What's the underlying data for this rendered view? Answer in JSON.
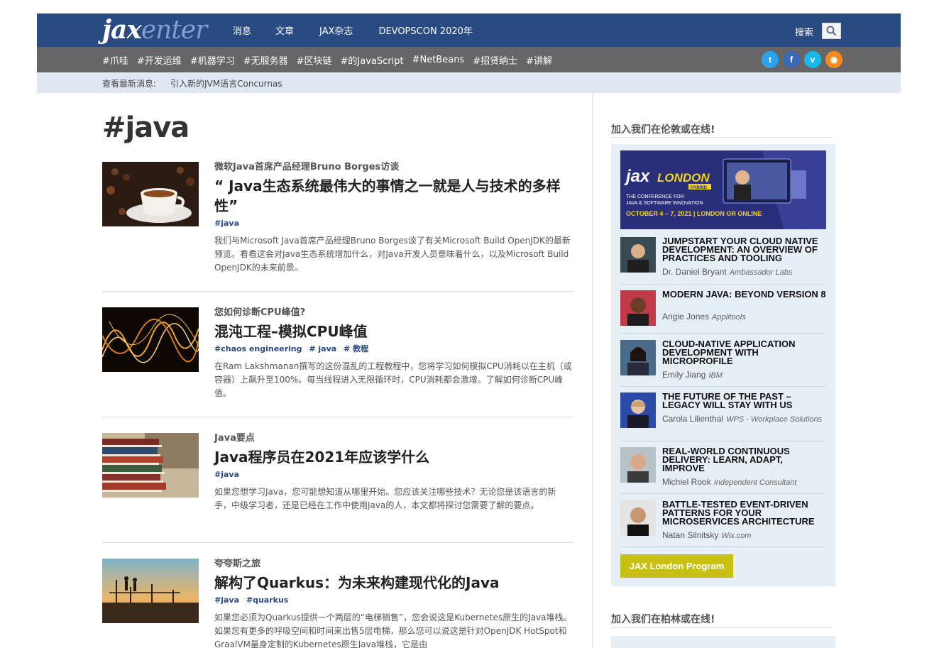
{
  "header": {
    "logo_jax": "jax",
    "logo_enter": "enter",
    "nav": [
      "消息",
      "文章",
      "JAX杂志",
      "DEVOPSCON 2020年"
    ],
    "search_label": "搜索"
  },
  "tagbar": {
    "tags": [
      "#爪哇",
      "#开发运维",
      "#机器学习",
      "#无服务器",
      "#区块链",
      "#的JavaScript",
      "#NetBeans",
      "#招贤纳士",
      "#讲解"
    ],
    "social": {
      "twitter": {
        "glyph": "t",
        "color": "#2aa3ef"
      },
      "facebook": {
        "glyph": "f",
        "color": "#3b69b5"
      },
      "vimeo": {
        "glyph": "v",
        "color": "#1ab7ea"
      },
      "rss": {
        "glyph": "◉",
        "color": "#f58a1f"
      }
    }
  },
  "ticker": {
    "label": "查看最新消息:",
    "headline": "引入新的JVM语言Concurnas"
  },
  "page_title": "#java",
  "articles": [
    {
      "kicker": "微软Java首席产品经理Bruno Borges访谈",
      "headline": "“ Java生态系统最伟大的事情之一就是人与技术的多样性”",
      "tags": [
        "#java"
      ],
      "excerpt": "我们与Microsoft Java首席产品经理Bruno Borges谈了有关Microsoft Build OpenJDK的最新预览。看看这会对Java生态系统增加什么，对Java开发人员意味着什么，以及Microsoft Build OpenJDK的未来前景。"
    },
    {
      "kicker": "您如何诊断CPU峰值?",
      "headline": "混沌工程–模拟CPU峰值",
      "tags": [
        "#chaos engineering",
        "# java",
        "# 教程"
      ],
      "excerpt": "在Ram Lakshmanan撰写的这份混乱的工程教程中，您将学习如何模拟CPU消耗以在主机（或容器）上飙升至100%。每当线程进入无限循环时，CPU消耗都会激增。了解如何诊断CPU峰值。"
    },
    {
      "kicker": "Java要点",
      "headline": "Java程序员在2021年应该学什么",
      "tags": [
        "#java"
      ],
      "excerpt": "如果您想学习Java，您可能想知道从哪里开始。您应该关注哪些技术？无论您是该语言的新手，中级学习者，还是已经在工作中使用Java的人，本文都将探讨您需要了解的要点。"
    },
    {
      "kicker": "夸夸斯之旅",
      "headline": "解构了Quarkus：为未来构建现代化的Java",
      "tags": [
        "#java",
        "#quarkus"
      ],
      "excerpt": "如果您必须为Quarkus提供一个两层的“电梯销售”，您会说这是Kubernetes原生的Java堆栈。如果您有更多的呼吸空间和时间来出售5层电梯，那么您可以说这是针对OpenJDK HotSpot和GraalVM量身定制的Kubernetes原生Java堆栈，它是由"
    }
  ],
  "sidebar": {
    "heading_london": "加入我们在伦敦或在线!",
    "banner": {
      "brand": "jax LONDON",
      "hybrid": "HYBRID",
      "subtitle": "THE CONFERENCE FOR JAVA & SOFTWARE INNOVATION",
      "dates": "OCTOBER 4 – 7, 2021 | LONDON OR ONLINE"
    },
    "talks": [
      {
        "title": "JUMPSTART YOUR CLOUD NATIVE DEVELOPMENT: AN OVERVIEW OF PRACTICES AND TOOLING",
        "speaker": "Dr. Daniel Bryant",
        "company": "Ambassador Labs"
      },
      {
        "title": "MODERN JAVA: BEYOND VERSION 8",
        "speaker": "Angie Jones",
        "company": "Applitools"
      },
      {
        "title": "CLOUD-NATIVE APPLICATION DEVELOPMENT WITH MICROPROFILE",
        "speaker": "Emily Jiang",
        "company": "IBM"
      },
      {
        "title": "THE FUTURE OF THE PAST – LEGACY WILL STAY WITH US",
        "speaker": "Carola Lilienthal",
        "company": "WPS - Workplace Solutions"
      },
      {
        "title": "REAL-WORLD CONTINUOUS DELIVERY: LEARN, ADAPT, IMPROVE",
        "speaker": "Michiel Rook",
        "company": "Independent Consultant"
      },
      {
        "title": "BATTLE-TESTED EVENT-DRIVEN PATTERNS FOR YOUR MICROSERVICES ARCHITECTURE",
        "speaker": "Natan Silnitsky",
        "company": "Wix.com"
      }
    ],
    "program_button": "JAX London Program",
    "heading_berlin": "加入我们在柏林或在线!"
  }
}
